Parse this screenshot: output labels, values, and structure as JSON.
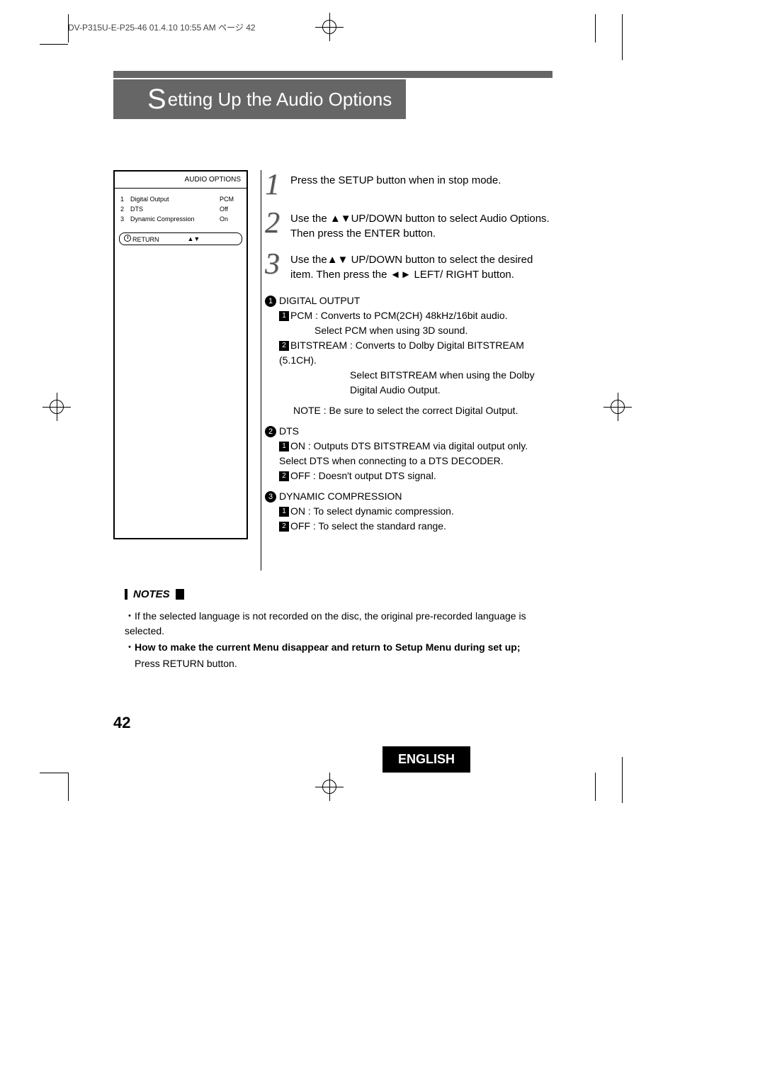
{
  "header": "DV-P315U-E-P25-46  01.4.10 10:55 AM  ページ 42",
  "title_prefix": "S",
  "title_rest": "etting Up the Audio Options",
  "menu": {
    "header": "AUDIO OPTIONS",
    "rows": [
      {
        "n": "1",
        "label": "Digital Output",
        "val": "PCM"
      },
      {
        "n": "2",
        "label": "DTS",
        "val": "Off"
      },
      {
        "n": "3",
        "label": "Dynamic Compression",
        "val": "On"
      }
    ],
    "return": "RETURN",
    "arrows": "▲▼"
  },
  "steps": {
    "s1": "Press the SETUP button when in stop mode.",
    "s2a": "Use the ",
    "s2b": "UP/DOWN button to select Audio Options. Then press the ENTER button.",
    "s3a": "Use the",
    "s3b": " UP/DOWN button to select the desired item. Then press the ",
    "s3c": " LEFT/ RIGHT button."
  },
  "details": {
    "d1_title": "DIGITAL OUTPUT",
    "d1_1a": "PCM : Converts to PCM(2CH) 48kHz/16bit audio.",
    "d1_1b": "Select PCM when using 3D sound.",
    "d1_2a": "BITSTREAM : Converts to Dolby Digital BITSTREAM (5.1CH).",
    "d1_2b": "Select BITSTREAM when using the Dolby Digital Audio Output.",
    "d1_note": "NOTE : Be sure to select the correct Digital Output.",
    "d2_title": "DTS",
    "d2_1": "ON : Outputs DTS BITSTREAM via digital output only. Select DTS when connecting to a DTS DECODER.",
    "d2_2": "OFF : Doesn't output DTS signal.",
    "d3_title": "DYNAMIC COMPRESSION",
    "d3_1": "ON : To select dynamic compression.",
    "d3_2": "OFF : To select the standard range."
  },
  "notes": {
    "title": "NOTES",
    "n1": "If the selected language is not recorded on the disc, the original pre-recorded language is selected.",
    "n2": "How to make the current Menu disappear and return to Setup Menu during set up;",
    "n3": "Press RETURN button."
  },
  "page_number": "42",
  "english": "ENGLISH"
}
